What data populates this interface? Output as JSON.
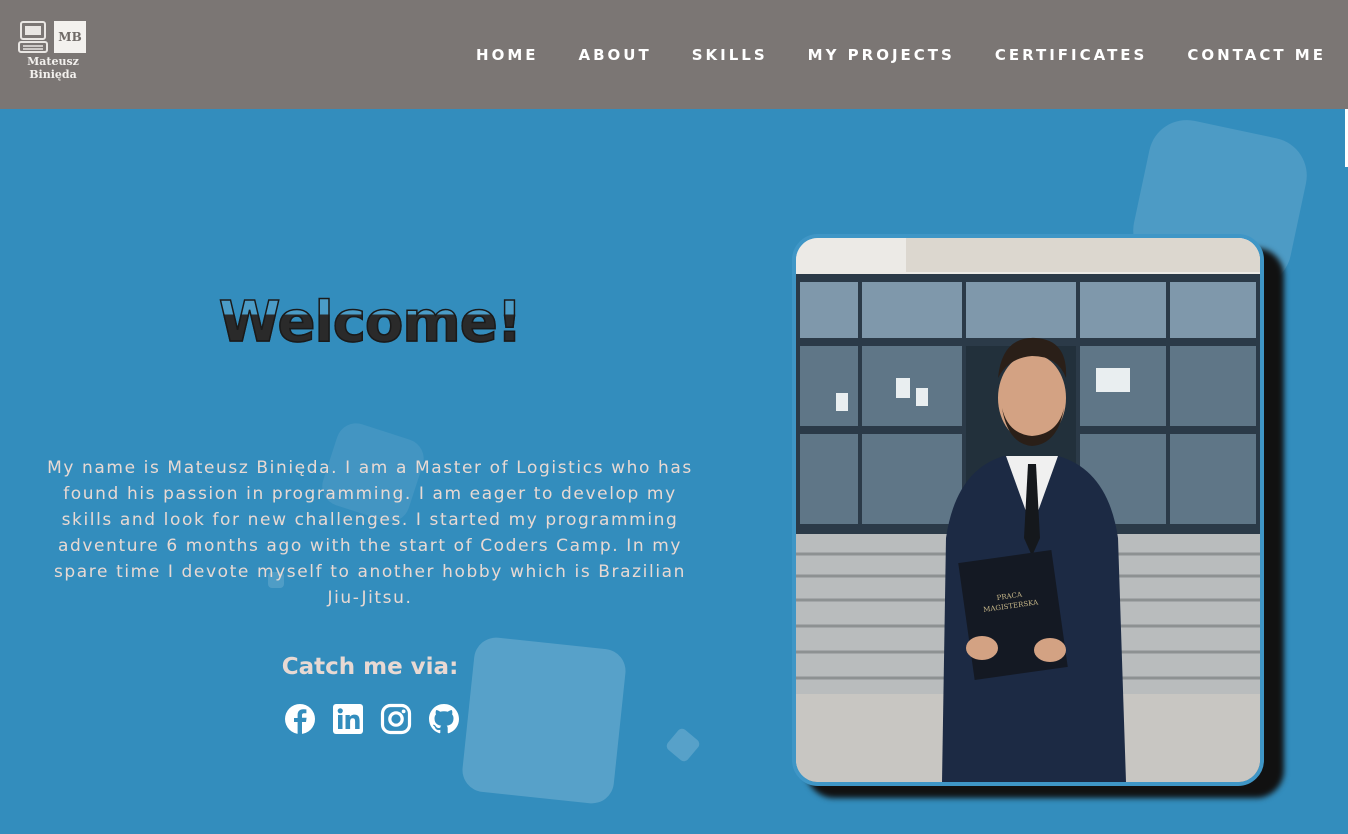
{
  "logo": {
    "initials": "MB",
    "name_line1": "Mateusz",
    "name_line2": "Binięda"
  },
  "nav": {
    "items": [
      {
        "label": "HOME"
      },
      {
        "label": "ABOUT"
      },
      {
        "label": "SKILLS"
      },
      {
        "label": "MY PROJECTS"
      },
      {
        "label": "CERTIFICATES"
      },
      {
        "label": "CONTACT ME"
      }
    ]
  },
  "hero": {
    "welcome": "Welcome!",
    "bio": "My name is Mateusz Binięda. I am a Master of Logistics who has found his passion in programming. I am eager to develop my skills and look for new challenges. I started my programming adventure 6 months ago with the start of Coders Camp. In my spare time I devote myself to another hobby which is Brazilian Jiu-Jitsu.",
    "catch_me": "Catch me via:",
    "socials": [
      {
        "icon": "facebook-icon"
      },
      {
        "icon": "linkedin-icon"
      },
      {
        "icon": "instagram-icon"
      },
      {
        "icon": "github-icon"
      }
    ]
  },
  "photo": {
    "folder_text_line1": "PRACA",
    "folder_text_line2": "MAGISTERSKA"
  },
  "colors": {
    "header_bg": "#7b7674",
    "page_bg": "#338dbd",
    "text_light": "#e8d9d3"
  }
}
